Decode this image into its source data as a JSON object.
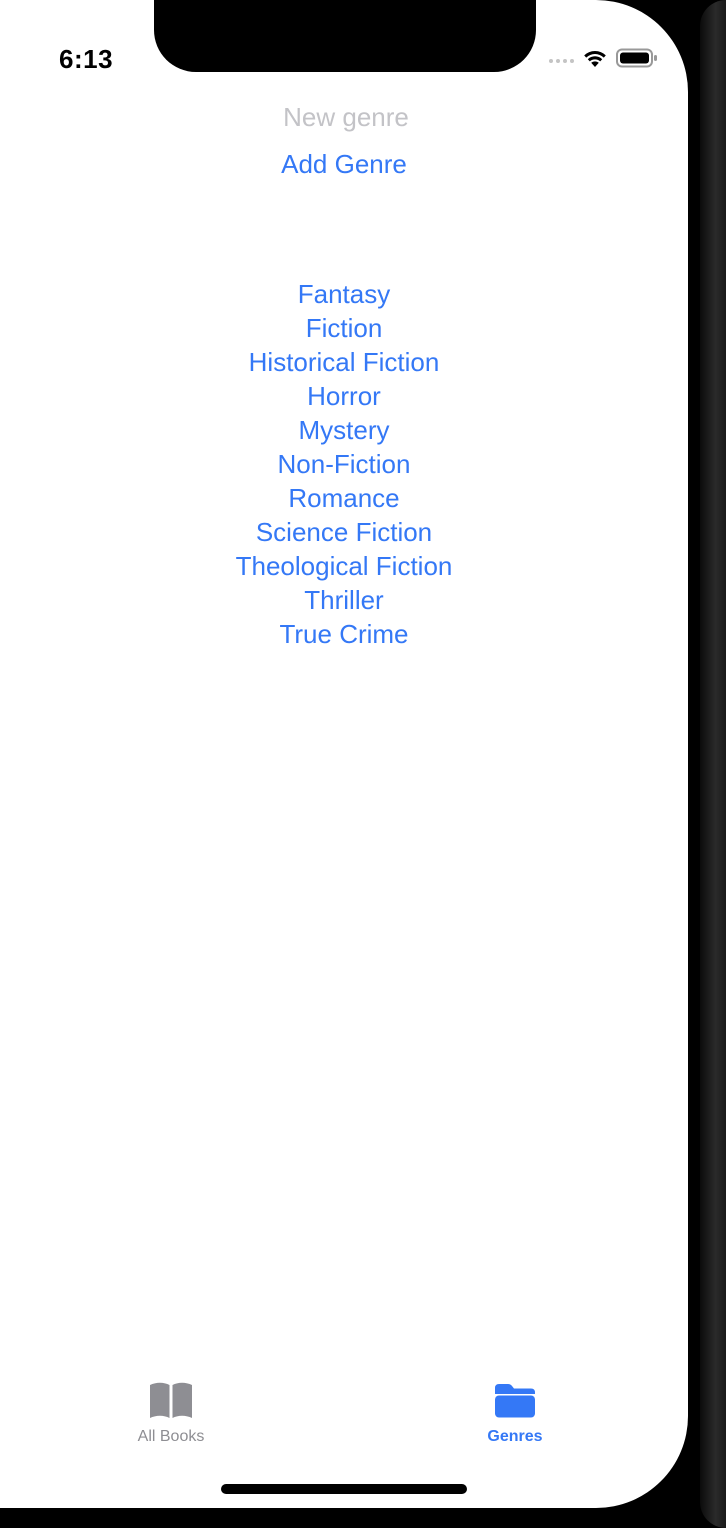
{
  "status_bar": {
    "time": "6:13"
  },
  "form": {
    "new_genre_placeholder": "New genre",
    "new_genre_value": "",
    "add_button_label": "Add Genre"
  },
  "genres": [
    "Fantasy",
    "Fiction",
    "Historical Fiction",
    "Horror",
    "Mystery",
    "Non-Fiction",
    "Romance",
    "Science Fiction",
    "Theological Fiction",
    "Thriller",
    "True Crime"
  ],
  "tab_bar": {
    "tabs": [
      {
        "label": "All Books",
        "icon": "book-icon",
        "selected": false
      },
      {
        "label": "Genres",
        "icon": "folder-icon",
        "selected": true
      }
    ]
  },
  "colors": {
    "accent": "#3478f6",
    "inactive_tab": "#8e8e93",
    "placeholder": "#c3c3c7"
  }
}
